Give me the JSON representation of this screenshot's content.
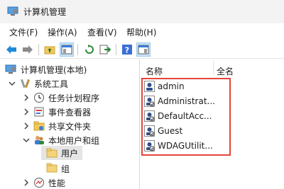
{
  "window": {
    "title": "计算机管理"
  },
  "menu": [
    "文件(F)",
    "操作(A)",
    "查看(V)",
    "帮助(H)"
  ],
  "tree": {
    "root": "计算机管理(本地)",
    "system_tools": "系统工具",
    "task_scheduler": "任务计划程序",
    "event_viewer": "事件查看器",
    "shared_folders": "共享文件夹",
    "local_users_groups": "本地用户和组",
    "users": "用户",
    "groups": "组",
    "performance": "性能"
  },
  "list": {
    "columns": [
      "名称",
      "全名"
    ],
    "users": [
      "admin",
      "Administrat...",
      "DefaultAcc...",
      "Guest",
      "WDAGUtilit..."
    ]
  },
  "colors": {
    "highlight": "#e4453c",
    "accent": "#0a64c8"
  }
}
